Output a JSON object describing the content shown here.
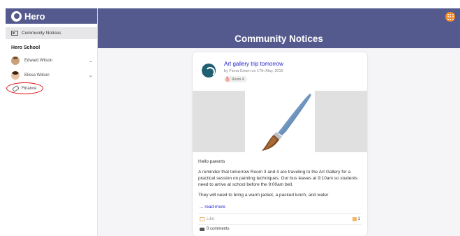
{
  "app": {
    "name": "Hero"
  },
  "sidebar": {
    "active_item": "Community Notices",
    "school_name": "Hero School",
    "children": [
      {
        "name": "Edward Wilson"
      },
      {
        "name": "Elissa Wilson"
      }
    ],
    "finance_label": "Finance"
  },
  "header": {
    "title": "Community Notices"
  },
  "notice": {
    "title": "Art gallery trip tomorrow",
    "meta": "by Fiona Green on 17th May, 2019",
    "class_tag": "Room 4",
    "greeting": "Hello parents",
    "paragraph1": "A reminder that tomorrow Room 3 and 4 are traveling to the Art Gallery for a practical session on painting techniques. Our bus leaves at 9:10am so students need to arrive at school before the 9:00am bell.",
    "paragraph2": "They will need to bring a warm jacket, a packed lunch, and water",
    "read_more": "... read more",
    "like_label": "Like",
    "like_count": "1",
    "comments_label": "0 comments"
  },
  "colors": {
    "brand": "#555a8e",
    "link": "#2222cc",
    "menu_button": "#f08a24",
    "annotation": "#e31b1b"
  }
}
